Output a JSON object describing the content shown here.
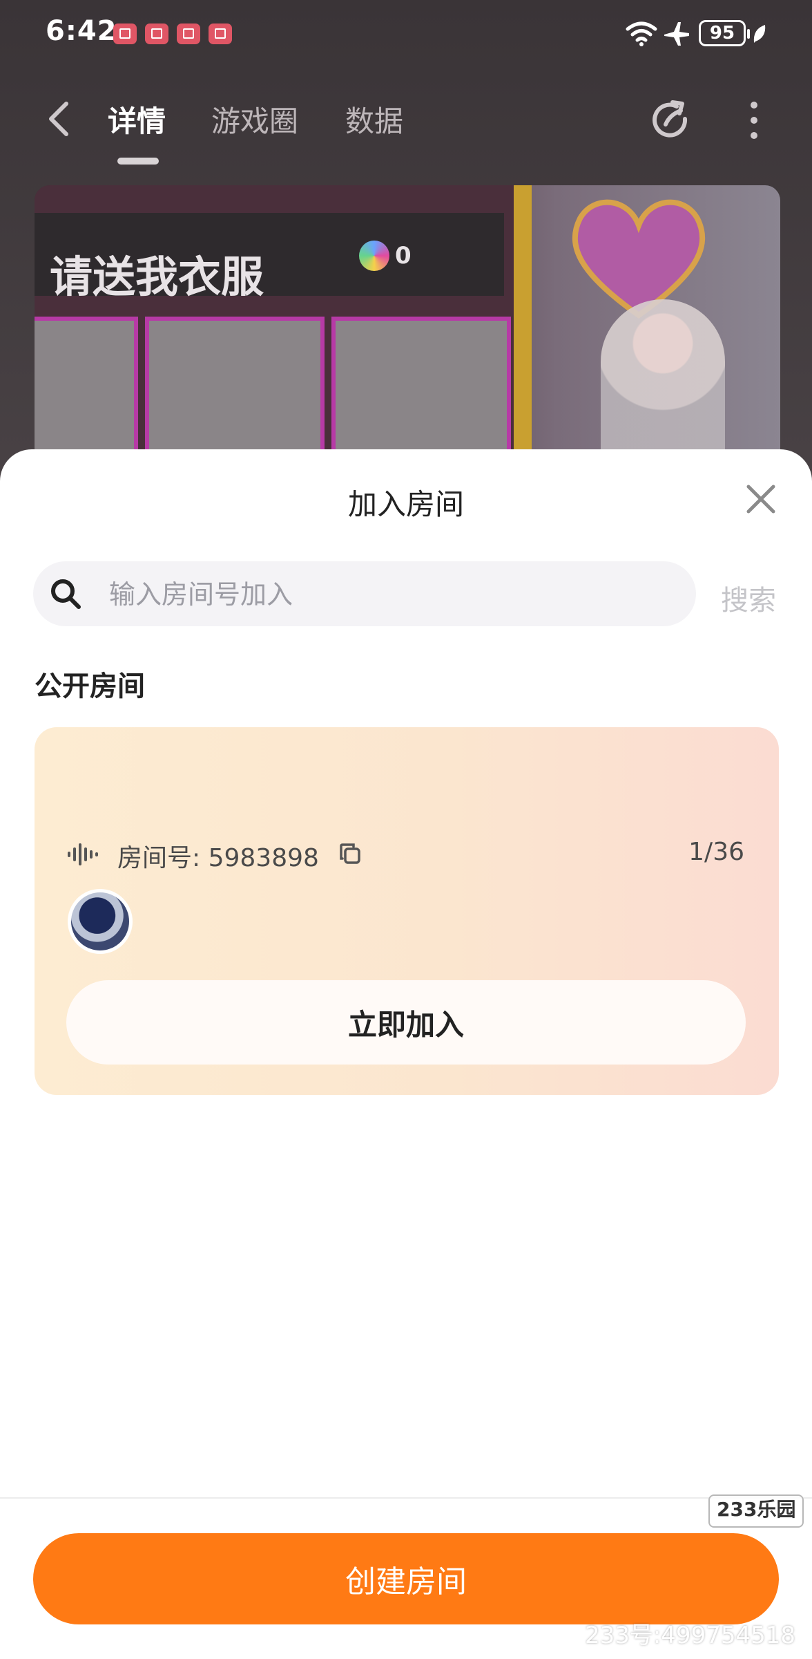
{
  "status_bar": {
    "time": "6:42",
    "battery": "95",
    "notification_count": 4,
    "icons": [
      "wifi-icon",
      "airplane-mode-icon",
      "battery-icon",
      "leaf-icon"
    ]
  },
  "nav": {
    "tabs": [
      {
        "label": "详情",
        "active": true
      },
      {
        "label": "游戏圈",
        "active": false
      },
      {
        "label": "数据",
        "active": false
      }
    ],
    "icons": [
      "back-arrow-icon",
      "share-icon",
      "more-icon"
    ]
  },
  "banner": {
    "title": "请送我衣服",
    "coin_value": "0"
  },
  "sheet": {
    "title": "加入房间",
    "search": {
      "placeholder": "输入房间号加入",
      "value": "",
      "button": "搜索"
    },
    "section_title": "公开房间",
    "room": {
      "number_label": "房间号: 5983898",
      "count": "1/36",
      "join_button": "立即加入"
    },
    "create_button": "创建房间"
  },
  "watermark": {
    "logo": "233乐园",
    "text": "233号:499754518"
  },
  "colors": {
    "accent": "#ff7a14",
    "card_gradient_start": "#fdecd2",
    "card_gradient_end": "#fbdcd2"
  }
}
